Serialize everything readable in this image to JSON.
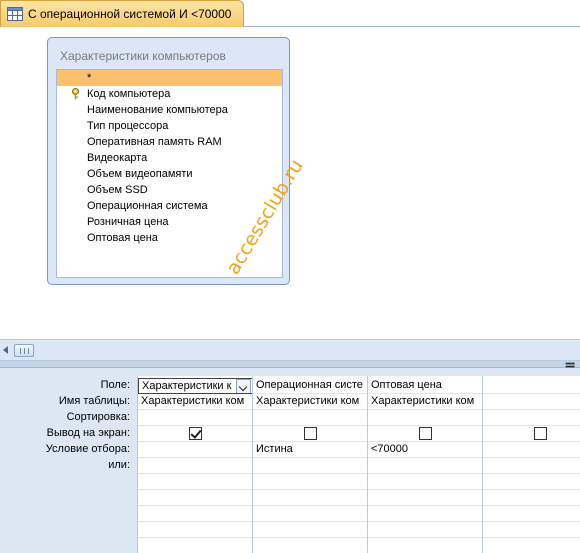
{
  "tab": {
    "icon": "query-icon",
    "title": "С операционной системой И <70000"
  },
  "table_window": {
    "title": "Характеристики компьютеров",
    "fields": [
      {
        "label": "*",
        "selected": true,
        "key": false
      },
      {
        "label": "Код компьютера",
        "selected": false,
        "key": true
      },
      {
        "label": "Наименование компьютера",
        "selected": false,
        "key": false
      },
      {
        "label": "Тип процессора",
        "selected": false,
        "key": false
      },
      {
        "label": "Оперативная память RAM",
        "selected": false,
        "key": false
      },
      {
        "label": "Видеокарта",
        "selected": false,
        "key": false
      },
      {
        "label": "Объем видеопамяти",
        "selected": false,
        "key": false
      },
      {
        "label": "Объем SSD",
        "selected": false,
        "key": false
      },
      {
        "label": "Операционная система",
        "selected": false,
        "key": false
      },
      {
        "label": "Розничная цена",
        "selected": false,
        "key": false
      },
      {
        "label": "Оптовая цена",
        "selected": false,
        "key": false
      }
    ]
  },
  "watermark": "accessclub.ru",
  "grid": {
    "row_labels": {
      "field": "Поле:",
      "table": "Имя таблицы:",
      "sort": "Сортировка:",
      "show": "Вывод на экран:",
      "criteria": "Условие отбора:",
      "or": "или:"
    },
    "columns": [
      {
        "field": "Характеристики к",
        "table": "Характеристики ком",
        "sort": "",
        "show": true,
        "criteria": "",
        "or": ""
      },
      {
        "field": "Операционная систе",
        "table": "Характеристики ком",
        "sort": "",
        "show": false,
        "criteria": "Истина",
        "or": ""
      },
      {
        "field": "Оптовая цена",
        "table": "Характеристики ком",
        "sort": "",
        "show": false,
        "criteria": "<70000",
        "or": ""
      },
      {
        "field": "",
        "table": "",
        "sort": "",
        "show": false,
        "criteria": "",
        "or": ""
      }
    ]
  },
  "colors": {
    "tab_active": "#f8c96b",
    "selection": "#fbbf6e",
    "pane_background": "#dde7f4",
    "watermark": "#f2a31a"
  }
}
